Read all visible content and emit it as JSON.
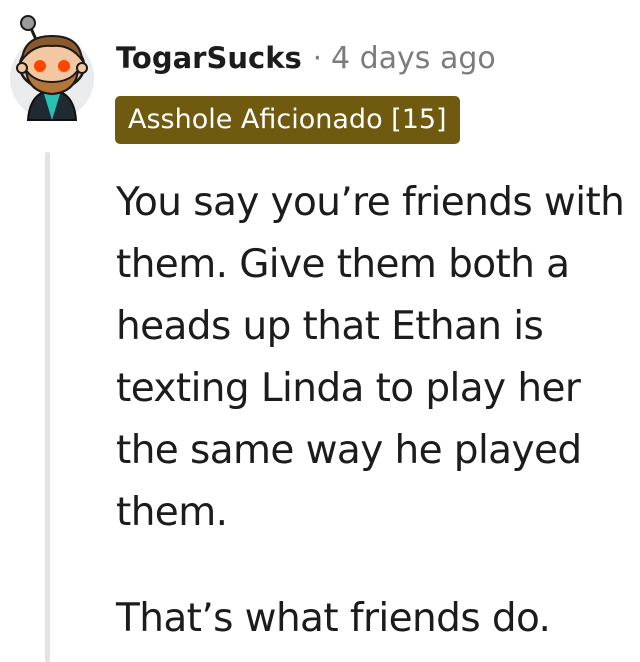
{
  "comment": {
    "author": "TogarSucks",
    "separator": "·",
    "timestamp": "4 days ago",
    "flair": "Asshole Aficionado [15]",
    "paragraphs": [
      "You say you’re friends with them. Give them both a heads up that Ethan is texting Linda to play her the same way he played them.",
      "That’s what friends do."
    ],
    "avatar_icon": "reddit-snoo-avatar-icon"
  },
  "colors": {
    "flair_bg": "#6f5a10",
    "flair_text": "#ffffff",
    "username": "#1c1c1c",
    "meta": "#7c7c7c",
    "body_text": "#1c1c1c",
    "thread_line": "#e3e3e3"
  }
}
